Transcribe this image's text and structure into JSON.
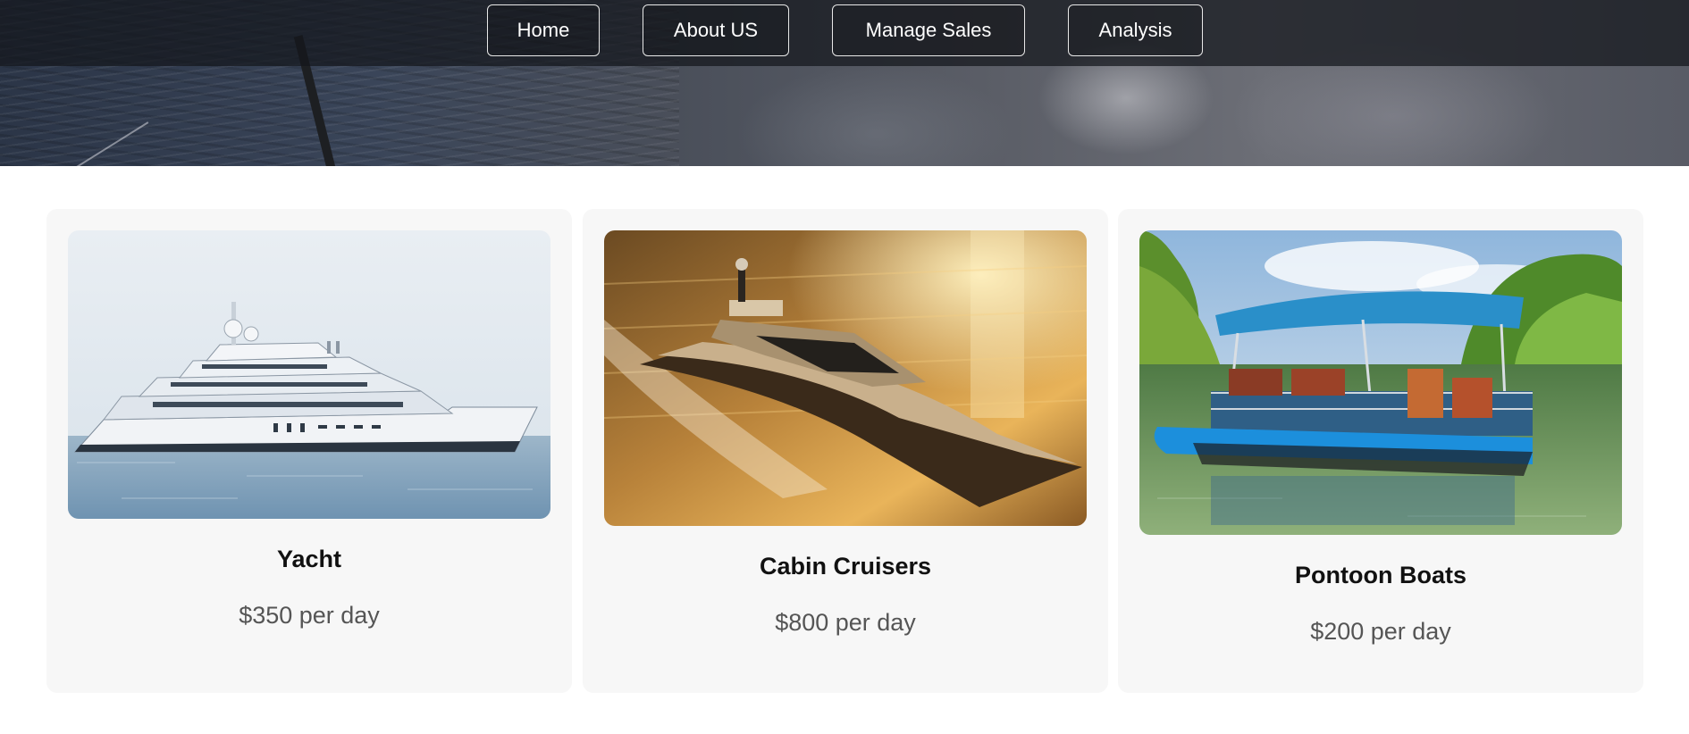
{
  "nav": {
    "items": [
      {
        "label": "Home"
      },
      {
        "label": "About US"
      },
      {
        "label": "Manage Sales"
      },
      {
        "label": "Analysis"
      }
    ]
  },
  "cards": [
    {
      "title": "Yacht",
      "price": "$350 per day",
      "image": "yacht-photo"
    },
    {
      "title": "Cabin Cruisers",
      "price": "$800 per day",
      "image": "cabin-cruiser-photo"
    },
    {
      "title": "Pontoon Boats",
      "price": "$200 per day",
      "image": "pontoon-boat-photo"
    }
  ],
  "colors": {
    "card_background": "#f7f7f7",
    "nav_overlay": "#14161c",
    "price_text": "#555555"
  }
}
